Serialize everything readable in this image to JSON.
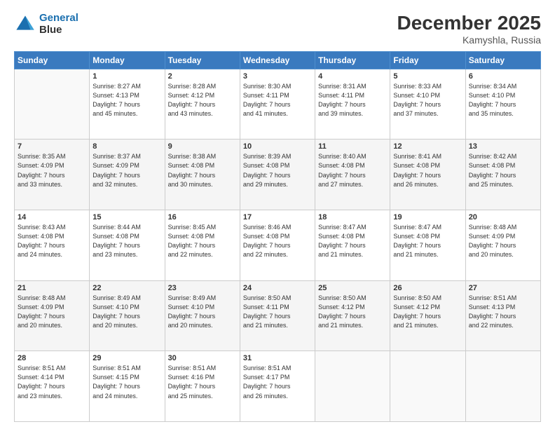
{
  "header": {
    "logo_line1": "General",
    "logo_line2": "Blue",
    "title": "December 2025",
    "subtitle": "Kamyshla, Russia"
  },
  "days_of_week": [
    "Sunday",
    "Monday",
    "Tuesday",
    "Wednesday",
    "Thursday",
    "Friday",
    "Saturday"
  ],
  "weeks": [
    [
      {
        "day": "",
        "sunrise": "",
        "sunset": "",
        "daylight": ""
      },
      {
        "day": "1",
        "sunrise": "Sunrise: 8:27 AM",
        "sunset": "Sunset: 4:13 PM",
        "daylight": "Daylight: 7 hours and 45 minutes."
      },
      {
        "day": "2",
        "sunrise": "Sunrise: 8:28 AM",
        "sunset": "Sunset: 4:12 PM",
        "daylight": "Daylight: 7 hours and 43 minutes."
      },
      {
        "day": "3",
        "sunrise": "Sunrise: 8:30 AM",
        "sunset": "Sunset: 4:11 PM",
        "daylight": "Daylight: 7 hours and 41 minutes."
      },
      {
        "day": "4",
        "sunrise": "Sunrise: 8:31 AM",
        "sunset": "Sunset: 4:11 PM",
        "daylight": "Daylight: 7 hours and 39 minutes."
      },
      {
        "day": "5",
        "sunrise": "Sunrise: 8:33 AM",
        "sunset": "Sunset: 4:10 PM",
        "daylight": "Daylight: 7 hours and 37 minutes."
      },
      {
        "day": "6",
        "sunrise": "Sunrise: 8:34 AM",
        "sunset": "Sunset: 4:10 PM",
        "daylight": "Daylight: 7 hours and 35 minutes."
      }
    ],
    [
      {
        "day": "7",
        "sunrise": "Sunrise: 8:35 AM",
        "sunset": "Sunset: 4:09 PM",
        "daylight": "Daylight: 7 hours and 33 minutes."
      },
      {
        "day": "8",
        "sunrise": "Sunrise: 8:37 AM",
        "sunset": "Sunset: 4:09 PM",
        "daylight": "Daylight: 7 hours and 32 minutes."
      },
      {
        "day": "9",
        "sunrise": "Sunrise: 8:38 AM",
        "sunset": "Sunset: 4:08 PM",
        "daylight": "Daylight: 7 hours and 30 minutes."
      },
      {
        "day": "10",
        "sunrise": "Sunrise: 8:39 AM",
        "sunset": "Sunset: 4:08 PM",
        "daylight": "Daylight: 7 hours and 29 minutes."
      },
      {
        "day": "11",
        "sunrise": "Sunrise: 8:40 AM",
        "sunset": "Sunset: 4:08 PM",
        "daylight": "Daylight: 7 hours and 27 minutes."
      },
      {
        "day": "12",
        "sunrise": "Sunrise: 8:41 AM",
        "sunset": "Sunset: 4:08 PM",
        "daylight": "Daylight: 7 hours and 26 minutes."
      },
      {
        "day": "13",
        "sunrise": "Sunrise: 8:42 AM",
        "sunset": "Sunset: 4:08 PM",
        "daylight": "Daylight: 7 hours and 25 minutes."
      }
    ],
    [
      {
        "day": "14",
        "sunrise": "Sunrise: 8:43 AM",
        "sunset": "Sunset: 4:08 PM",
        "daylight": "Daylight: 7 hours and 24 minutes."
      },
      {
        "day": "15",
        "sunrise": "Sunrise: 8:44 AM",
        "sunset": "Sunset: 4:08 PM",
        "daylight": "Daylight: 7 hours and 23 minutes."
      },
      {
        "day": "16",
        "sunrise": "Sunrise: 8:45 AM",
        "sunset": "Sunset: 4:08 PM",
        "daylight": "Daylight: 7 hours and 22 minutes."
      },
      {
        "day": "17",
        "sunrise": "Sunrise: 8:46 AM",
        "sunset": "Sunset: 4:08 PM",
        "daylight": "Daylight: 7 hours and 22 minutes."
      },
      {
        "day": "18",
        "sunrise": "Sunrise: 8:47 AM",
        "sunset": "Sunset: 4:08 PM",
        "daylight": "Daylight: 7 hours and 21 minutes."
      },
      {
        "day": "19",
        "sunrise": "Sunrise: 8:47 AM",
        "sunset": "Sunset: 4:08 PM",
        "daylight": "Daylight: 7 hours and 21 minutes."
      },
      {
        "day": "20",
        "sunrise": "Sunrise: 8:48 AM",
        "sunset": "Sunset: 4:09 PM",
        "daylight": "Daylight: 7 hours and 20 minutes."
      }
    ],
    [
      {
        "day": "21",
        "sunrise": "Sunrise: 8:48 AM",
        "sunset": "Sunset: 4:09 PM",
        "daylight": "Daylight: 7 hours and 20 minutes."
      },
      {
        "day": "22",
        "sunrise": "Sunrise: 8:49 AM",
        "sunset": "Sunset: 4:10 PM",
        "daylight": "Daylight: 7 hours and 20 minutes."
      },
      {
        "day": "23",
        "sunrise": "Sunrise: 8:49 AM",
        "sunset": "Sunset: 4:10 PM",
        "daylight": "Daylight: 7 hours and 20 minutes."
      },
      {
        "day": "24",
        "sunrise": "Sunrise: 8:50 AM",
        "sunset": "Sunset: 4:11 PM",
        "daylight": "Daylight: 7 hours and 21 minutes."
      },
      {
        "day": "25",
        "sunrise": "Sunrise: 8:50 AM",
        "sunset": "Sunset: 4:12 PM",
        "daylight": "Daylight: 7 hours and 21 minutes."
      },
      {
        "day": "26",
        "sunrise": "Sunrise: 8:50 AM",
        "sunset": "Sunset: 4:12 PM",
        "daylight": "Daylight: 7 hours and 21 minutes."
      },
      {
        "day": "27",
        "sunrise": "Sunrise: 8:51 AM",
        "sunset": "Sunset: 4:13 PM",
        "daylight": "Daylight: 7 hours and 22 minutes."
      }
    ],
    [
      {
        "day": "28",
        "sunrise": "Sunrise: 8:51 AM",
        "sunset": "Sunset: 4:14 PM",
        "daylight": "Daylight: 7 hours and 23 minutes."
      },
      {
        "day": "29",
        "sunrise": "Sunrise: 8:51 AM",
        "sunset": "Sunset: 4:15 PM",
        "daylight": "Daylight: 7 hours and 24 minutes."
      },
      {
        "day": "30",
        "sunrise": "Sunrise: 8:51 AM",
        "sunset": "Sunset: 4:16 PM",
        "daylight": "Daylight: 7 hours and 25 minutes."
      },
      {
        "day": "31",
        "sunrise": "Sunrise: 8:51 AM",
        "sunset": "Sunset: 4:17 PM",
        "daylight": "Daylight: 7 hours and 26 minutes."
      },
      {
        "day": "",
        "sunrise": "",
        "sunset": "",
        "daylight": ""
      },
      {
        "day": "",
        "sunrise": "",
        "sunset": "",
        "daylight": ""
      },
      {
        "day": "",
        "sunrise": "",
        "sunset": "",
        "daylight": ""
      }
    ]
  ]
}
